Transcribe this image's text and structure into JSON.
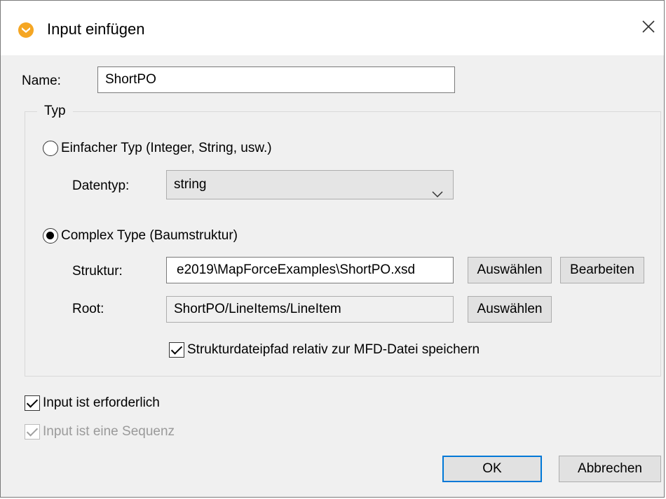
{
  "window": {
    "title": "Input einfügen",
    "icon": "mapforce-app-icon",
    "close_icon": "close-icon"
  },
  "name": {
    "label": "Name:",
    "value": "ShortPO"
  },
  "type_group": {
    "legend": "Typ",
    "simple": {
      "label": "Einfacher Typ (Integer, String, usw.)",
      "selected": false,
      "datatype_label": "Datentyp:",
      "datatype_value": "string"
    },
    "complex": {
      "label": "Complex Type (Baumstruktur)",
      "selected": true,
      "structure_label": "Struktur:",
      "structure_value": "e2019\\MapForceExamples\\ShortPO.xsd",
      "select_button": "Auswählen",
      "edit_button": "Bearbeiten",
      "root_label": "Root:",
      "root_value": "ShortPO/LineItems/LineItem",
      "root_select_button": "Auswählen",
      "relative_path_label": "Strukturdateipfad relativ zur MFD-Datei speichern",
      "relative_path_checked": true
    }
  },
  "options": {
    "required_label": "Input ist erforderlich",
    "required_checked": true,
    "sequence_label": "Input ist eine Sequenz",
    "sequence_checked": true,
    "sequence_disabled": true
  },
  "footer": {
    "ok_label": "OK",
    "cancel_label": "Abbrechen"
  },
  "colors": {
    "accent": "#0078d7",
    "icon_orange": "#f5a623"
  }
}
